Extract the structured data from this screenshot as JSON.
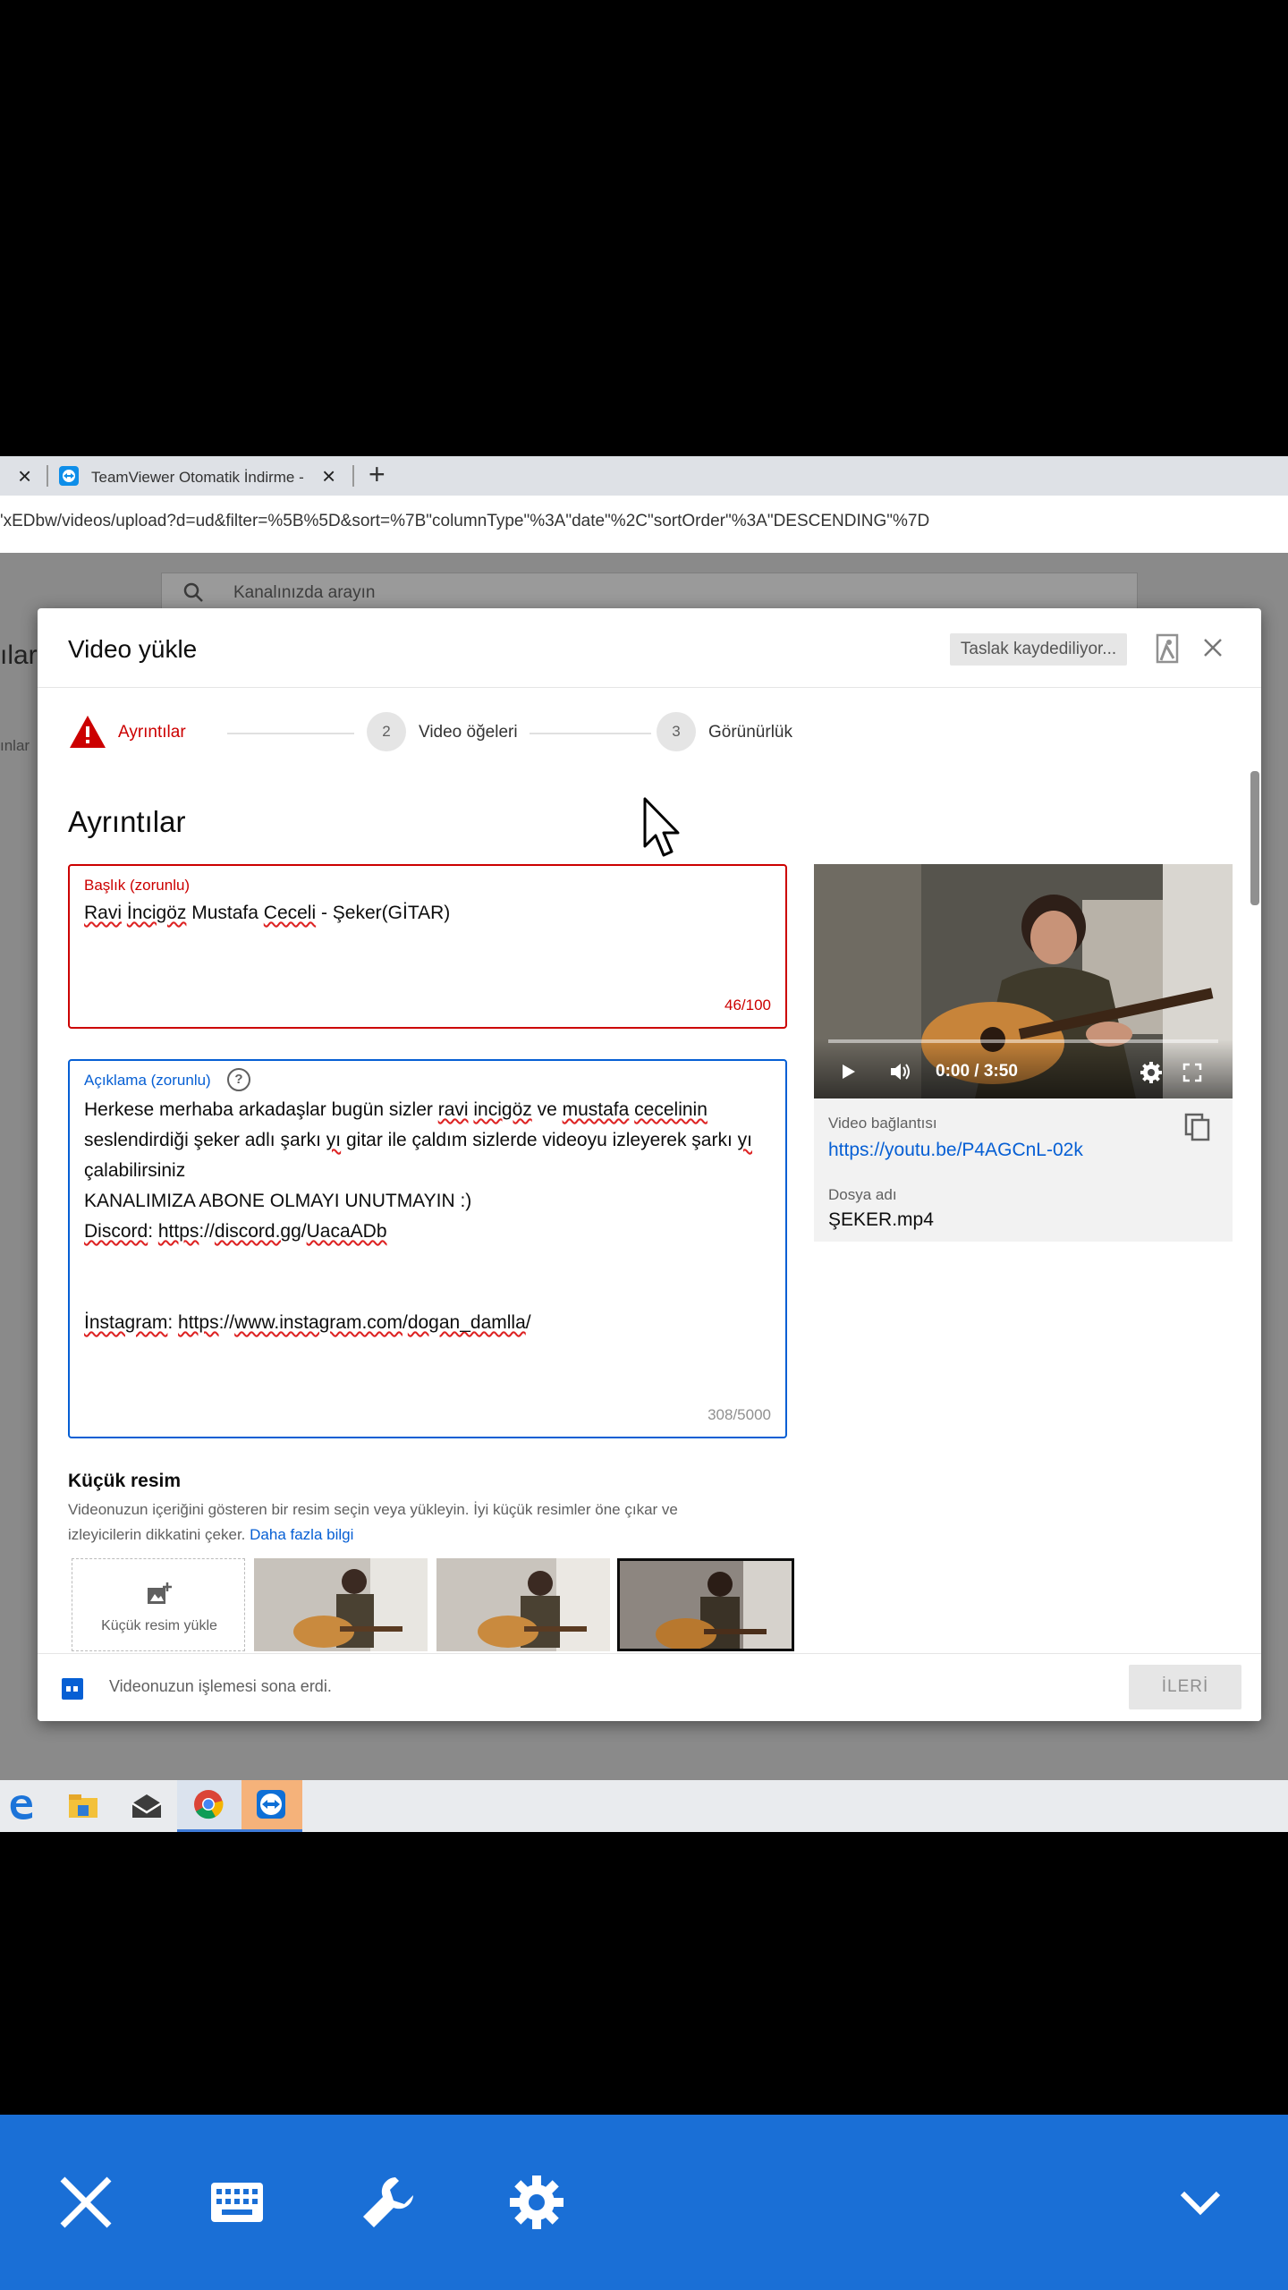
{
  "browser": {
    "tab_partial_close": "×",
    "tab2_title": "TeamViewer Otomatik İndirme -",
    "tab2_close": "×",
    "new_tab": "+",
    "url": "'xEDbw/videos/upload?d=ud&filter=%5B%5D&sort=%7B\"columnType\"%3A\"date\"%2C\"sortOrder\"%3A\"DESCENDING\"%7D"
  },
  "studio": {
    "search_placeholder": "Kanalınızda arayın",
    "side_text_1": "ılar",
    "side_text_2": "ınlar"
  },
  "dialog": {
    "title": "Video yükle",
    "draft_status": "Taslak kaydediliyor...",
    "steps": [
      {
        "num": "",
        "label": "Ayrıntılar"
      },
      {
        "num": "2",
        "label": "Video öğeleri"
      },
      {
        "num": "3",
        "label": "Görünürlük"
      }
    ],
    "section_title": "Ayrıntılar",
    "title_field": {
      "label": "Başlık (zorunlu)",
      "value_parts": [
        "Ravi",
        " ",
        "İncigöz",
        " Mustafa ",
        "Ceceli",
        " - Şeker(GİTAR)"
      ],
      "counter": "46/100"
    },
    "description_field": {
      "label": "Açıklama (zorunlu)",
      "help_icon": "?",
      "line1": [
        "Herkese merhaba arkadaşlar bugün sizler ",
        "ravi",
        " ",
        "incigöz",
        " ve ",
        "mustafa",
        " ",
        "cecelinin"
      ],
      "line2": [
        "seslendirdiği şeker adlı şarkı ",
        "yı",
        " gitar ile çaldım sizlerde videoyu izleyerek şarkı ",
        "yı"
      ],
      "line3": "çalabilirsiniz",
      "line4": "KANALIMIZA ABONE OLMAYI UNUTMAYIN :)",
      "line5": [
        "Discord",
        ": ",
        "https",
        "://",
        "discord.gg",
        "/",
        "UacaADb"
      ],
      "line6": [
        "İnstagram",
        ": ",
        "https",
        "://",
        "www.instagram.com",
        "/",
        "dogan_damlla",
        "/"
      ],
      "counter": "308/5000"
    },
    "thumbnail": {
      "title": "Küçük resim",
      "desc_line1": "Videonuzun içeriğini gösteren bir resim seçin veya yükleyin. İyi küçük resimler öne çıkar ve",
      "desc_line2": "izleyicilerin dikkatini çeker.",
      "more_link": "Daha fazla bilgi",
      "upload_label": "Küçük resim yükle"
    },
    "video": {
      "time": "0:00 / 3:50",
      "link_label": "Video bağlantısı",
      "link": "https://youtu.be/P4AGCnL-02k",
      "file_label": "Dosya adı",
      "file_name": "ŞEKER.mp4"
    },
    "footer": {
      "status": "Videonuzun işlemesi sona erdi.",
      "next_button": "İLERİ"
    }
  },
  "colors": {
    "error": "#cc0000",
    "accent": "#065fd4",
    "teamviewer_blue": "#1a6fd6"
  },
  "teamviewer_toolbar": {
    "icons": [
      "close-icon",
      "keyboard-icon",
      "wrench-icon",
      "gear-icon",
      "chevron-down-icon"
    ]
  }
}
